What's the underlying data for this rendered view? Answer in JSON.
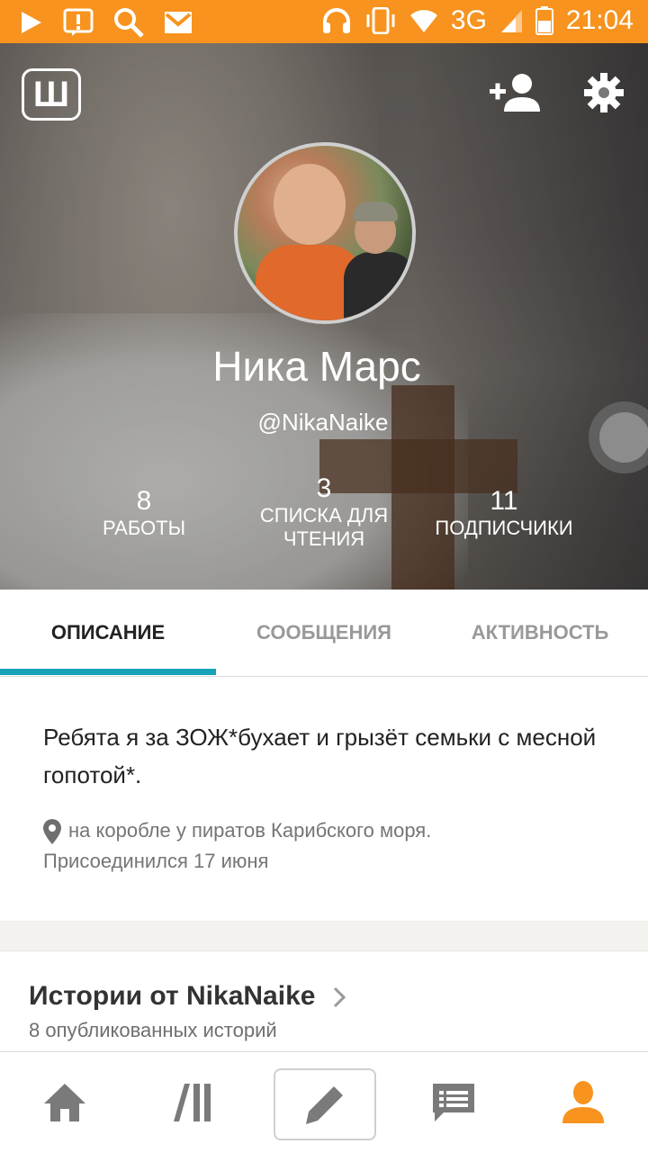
{
  "status_bar": {
    "time": "21:04",
    "network": "3G",
    "icons": [
      "play-icon",
      "alert-icon",
      "search-icon",
      "gmail-icon",
      "headphones-icon",
      "vibrate-icon",
      "wifi-icon",
      "signal-icon",
      "battery-icon"
    ]
  },
  "header": {
    "logo_letter": "Ш"
  },
  "profile": {
    "name": "Ника Марс",
    "username": "@NikaNaike",
    "stats": [
      {
        "value": "8",
        "label": "Работы"
      },
      {
        "value": "3",
        "label": "Списка для чтения"
      },
      {
        "value": "11",
        "label": "Подписчики"
      }
    ]
  },
  "tabs": [
    {
      "label": "ОПИСАНИЕ",
      "active": true
    },
    {
      "label": "СООБЩЕНИЯ",
      "active": false
    },
    {
      "label": "АКТИВНОСТЬ",
      "active": false
    }
  ],
  "about": {
    "description": "Ребята я за ЗОЖ*бухает и грызёт семьки с месной гопотой*.",
    "location": "на  коробле у пиратов Карибского моря.",
    "joined": "Присоединился 17 июня"
  },
  "stories": {
    "title": "Истории от NikaNaike",
    "subtitle": "8 опубликованных историй"
  },
  "bottom_nav": [
    "home-icon",
    "library-icon",
    "write-icon",
    "messages-icon",
    "profile-icon"
  ],
  "colors": {
    "accent_orange": "#f7931e",
    "tab_indicator": "#17a2b8"
  }
}
